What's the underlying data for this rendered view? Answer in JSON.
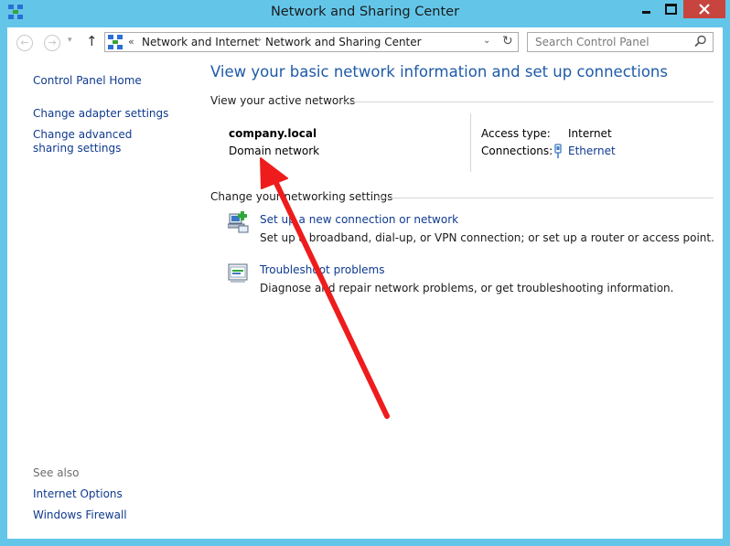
{
  "window": {
    "title": "Network and Sharing Center",
    "controls": {
      "minimize": "minimize",
      "maximize": "maximize",
      "close": "close"
    }
  },
  "nav": {
    "back_glyph": "←",
    "forward_glyph": "→",
    "recent_glyph": "▾",
    "up_glyph": "↑",
    "address": {
      "prefix": "«",
      "breadcrumbs": [
        "Network and Internet",
        "Network and Sharing Center"
      ],
      "separator": "›",
      "dropdown_glyph": "⌄",
      "refresh_glyph": "↻"
    },
    "search": {
      "placeholder": "Search Control Panel"
    }
  },
  "sidebar": {
    "home": "Control Panel Home",
    "links": [
      "Change adapter settings",
      "Change advanced sharing settings"
    ],
    "see_also_label": "See also",
    "see_also": [
      "Internet Options",
      "Windows Firewall"
    ]
  },
  "main": {
    "title": "View your basic network information and set up connections",
    "active_networks_header": "View your active networks",
    "network": {
      "name": "company.local",
      "type": "Domain network",
      "access_type_label": "Access type:",
      "access_type_value": "Internet",
      "connections_label": "Connections:",
      "connections_value": "Ethernet"
    },
    "change_settings_header": "Change your networking settings",
    "tasks": [
      {
        "icon": "new-connection-icon",
        "link": "Set up a new connection or network",
        "description": "Set up a broadband, dial-up, or VPN connection; or set up a router or access point."
      },
      {
        "icon": "troubleshoot-icon",
        "link": "Troubleshoot problems",
        "description": "Diagnose and repair network problems, or get troubleshooting information."
      }
    ]
  },
  "colors": {
    "frame": "#63c6e9",
    "link": "#0f3a8f",
    "title": "#1e5aa8",
    "close": "#c7443f",
    "annotation_arrow": "#ee1c1c"
  }
}
